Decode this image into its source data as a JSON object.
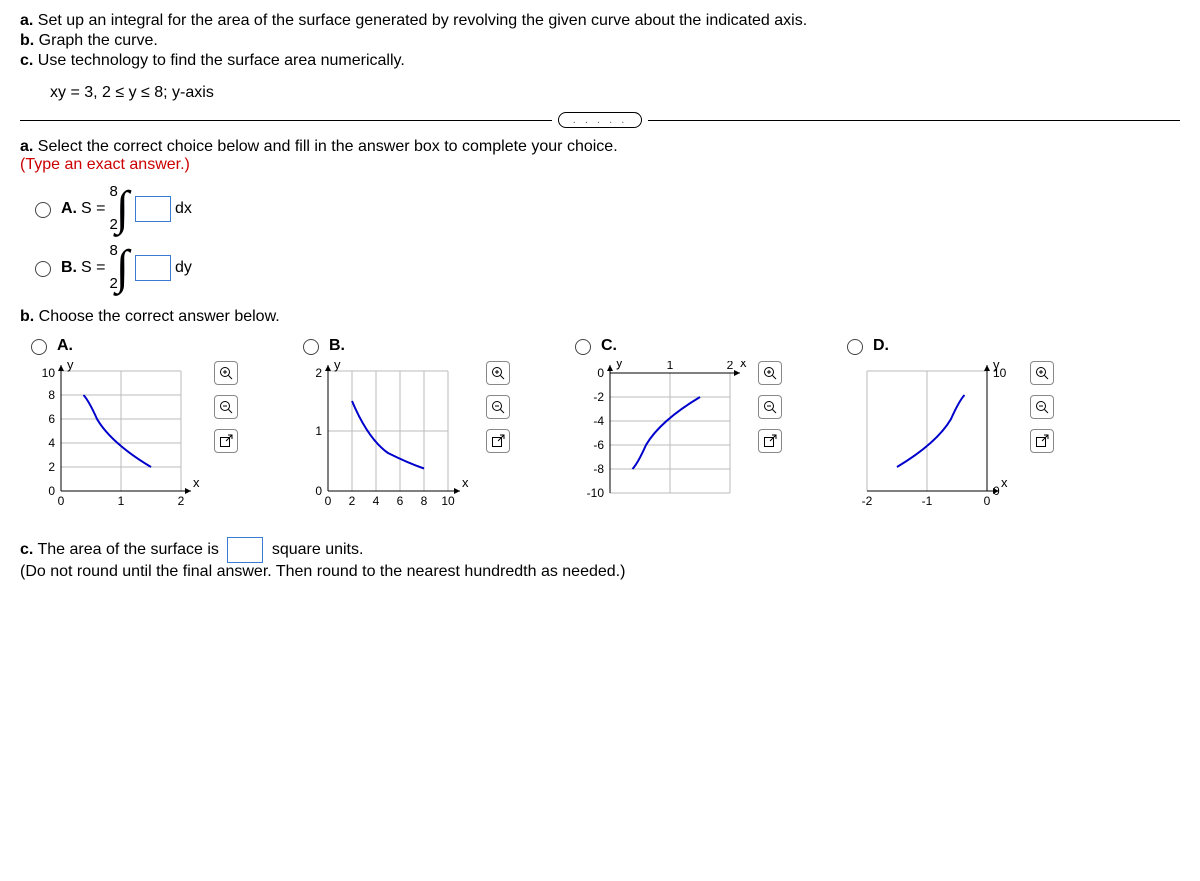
{
  "prompt": {
    "a": "a.",
    "a_text": " Set up an integral for the area of the surface generated by revolving the given curve about the indicated axis.",
    "b": "b.",
    "b_text": " Graph the curve.",
    "c": "c.",
    "c_text": " Use technology to find the surface area numerically.",
    "equation": "xy = 3, 2 ≤ y ≤ 8; y-axis"
  },
  "divider": ". . . . .",
  "part_a": {
    "heading_bold": "a.",
    "heading_rest": " Select the correct choice below and fill in the answer box to complete your choice.",
    "hint": "(Type an exact answer.)",
    "choices": [
      {
        "label": "A.",
        "lhs": " S = ",
        "upper": "8",
        "lower": "2",
        "diff": " dx"
      },
      {
        "label": "B.",
        "lhs": " S = ",
        "upper": "8",
        "lower": "2",
        "diff": " dy"
      }
    ]
  },
  "part_b": {
    "heading_bold": "b.",
    "heading_rest": " Choose the correct answer below.",
    "choices": [
      "A.",
      "B.",
      "C.",
      "D."
    ]
  },
  "part_c": {
    "heading_bold": "c.",
    "heading_text1": " The area of the surface is ",
    "heading_text2": " square units.",
    "hint": "(Do not round until the final answer. Then round to the nearest hundredth as needed.)"
  },
  "icons": {
    "zoom_in": "zoom-in-icon",
    "zoom_out": "zoom-out-icon",
    "popout": "popout-icon"
  },
  "chart_data": [
    {
      "type": "line",
      "title": "A",
      "xlabel": "x",
      "ylabel": "y",
      "xlim": [
        0,
        2
      ],
      "ylim": [
        0,
        10
      ],
      "xticks": [
        0,
        1,
        2
      ],
      "yticks": [
        0,
        2,
        4,
        6,
        8,
        10
      ],
      "curve": "x = 3/y, 2≤y≤8",
      "points": [
        [
          1.5,
          2
        ],
        [
          1.0,
          3
        ],
        [
          0.75,
          4
        ],
        [
          0.6,
          5
        ],
        [
          0.5,
          6
        ],
        [
          0.4286,
          7
        ],
        [
          0.375,
          8
        ]
      ]
    },
    {
      "type": "line",
      "title": "B",
      "xlabel": "x",
      "ylabel": "y",
      "xlim": [
        0,
        10
      ],
      "ylim": [
        0,
        2
      ],
      "xticks": [
        0,
        2,
        4,
        6,
        8,
        10
      ],
      "yticks": [
        0,
        1,
        2
      ],
      "curve": "y = 3/x, 2≤x≤8",
      "points": [
        [
          2,
          1.5
        ],
        [
          3,
          1.0
        ],
        [
          4,
          0.75
        ],
        [
          5,
          0.6
        ],
        [
          6,
          0.5
        ],
        [
          7,
          0.4286
        ],
        [
          8,
          0.375
        ]
      ]
    },
    {
      "type": "line",
      "title": "C",
      "xlabel": "x",
      "ylabel": "y",
      "xlim": [
        0,
        2
      ],
      "ylim": [
        -10,
        0
      ],
      "xticks": [
        0,
        1,
        2
      ],
      "yticks": [
        -10,
        -8,
        -6,
        -4,
        -2,
        0
      ],
      "curve": "x = -3/y",
      "points": [
        [
          1.5,
          -2
        ],
        [
          1.0,
          -3
        ],
        [
          0.75,
          -4
        ],
        [
          0.6,
          -5
        ],
        [
          0.5,
          -6
        ],
        [
          0.4286,
          -7
        ],
        [
          0.375,
          -8
        ]
      ]
    },
    {
      "type": "line",
      "title": "D",
      "xlabel": "x",
      "ylabel": "y",
      "xlim": [
        -2,
        0
      ],
      "ylim": [
        0,
        10
      ],
      "xticks": [
        -2,
        -1,
        0
      ],
      "yticks": [
        0,
        10
      ],
      "curve": "x = -3/y",
      "points": [
        [
          -1.5,
          2
        ],
        [
          -1.0,
          3
        ],
        [
          -0.75,
          4
        ],
        [
          -0.6,
          5
        ],
        [
          -0.5,
          6
        ],
        [
          -0.4286,
          7
        ],
        [
          -0.375,
          8
        ]
      ]
    }
  ]
}
